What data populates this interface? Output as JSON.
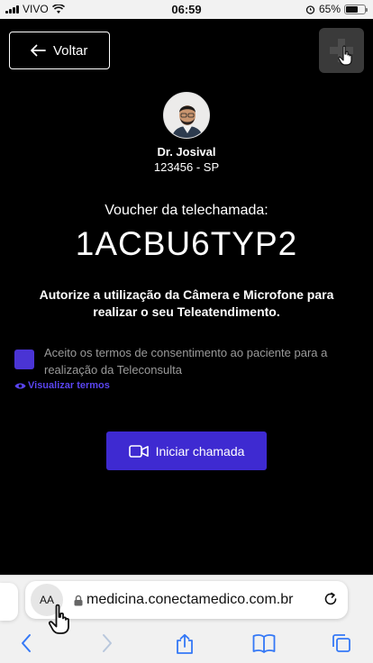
{
  "status_bar": {
    "carrier": "VIVO",
    "time": "06:59",
    "battery": "65%",
    "battery_level": 0.65
  },
  "header": {
    "back_label": "Voltar"
  },
  "doctor": {
    "name": "Dr. Josival",
    "crm": "123456 - SP"
  },
  "voucher": {
    "label": "Voucher da telechamada:",
    "code": "1ACBU6TYP2"
  },
  "authorization_text": "Autorize a utilização da Câmera e Microfone para realizar o seu Teleatendimento.",
  "consent": {
    "text": "Aceito os termos de consentimento ao paciente para a realização da Teleconsulta",
    "checked": true,
    "view_terms": "Visualizar termos"
  },
  "call_button": {
    "label": "Iniciar chamada"
  },
  "browser": {
    "text_size_label": "AA",
    "url": "medicina.conectamedico.com.br"
  },
  "colors": {
    "accent": "#3e2ad1",
    "link": "#5a45f0",
    "background": "#000000"
  }
}
